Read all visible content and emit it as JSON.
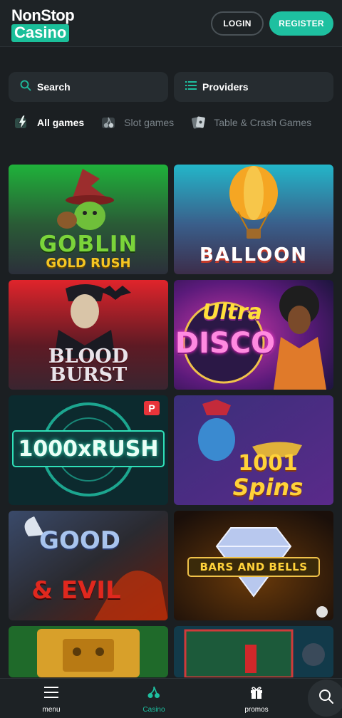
{
  "brand": {
    "line1": "NonStop",
    "line2": "Casino",
    "accent": "#1ec0a0"
  },
  "header": {
    "login_label": "LOGIN",
    "register_label": "REGISTER"
  },
  "search": {
    "label": "Search",
    "icon": "search-icon"
  },
  "providers": {
    "label": "Providers",
    "icon": "list-icon"
  },
  "filters": [
    {
      "label": "All games",
      "icon": "lightning-icon",
      "active": true
    },
    {
      "label": "Slot games",
      "icon": "cherry-icon",
      "active": false
    },
    {
      "label": "Table & Crash Games",
      "icon": "cards-icon",
      "active": false
    }
  ],
  "games": [
    {
      "title_line1": "GOBLIN",
      "title_line2": "GOLD RUSH"
    },
    {
      "title_line1": "BALLOON",
      "title_line2": ""
    },
    {
      "title_line1": "BLOOD",
      "title_line2": "BURST"
    },
    {
      "title_line1": "Ultra",
      "title_line2": "DISCO"
    },
    {
      "title_line1": "1000xRUSH",
      "title_line2": "",
      "badge": "P"
    },
    {
      "title_line1": "1001",
      "title_line2": "Spins"
    },
    {
      "title_line1": "GOOD",
      "title_line2": "& EVIL"
    },
    {
      "title_line1": "BARS AND BELLS",
      "title_line2": ""
    },
    {
      "title_line1": "",
      "title_line2": ""
    },
    {
      "title_line1": "",
      "title_line2": ""
    }
  ],
  "bottom_nav": [
    {
      "label": "menu",
      "icon": "hamburger-icon",
      "active": false
    },
    {
      "label": "Casino",
      "icon": "cherry-icon",
      "active": true
    },
    {
      "label": "promos",
      "icon": "gift-icon",
      "active": false
    }
  ]
}
